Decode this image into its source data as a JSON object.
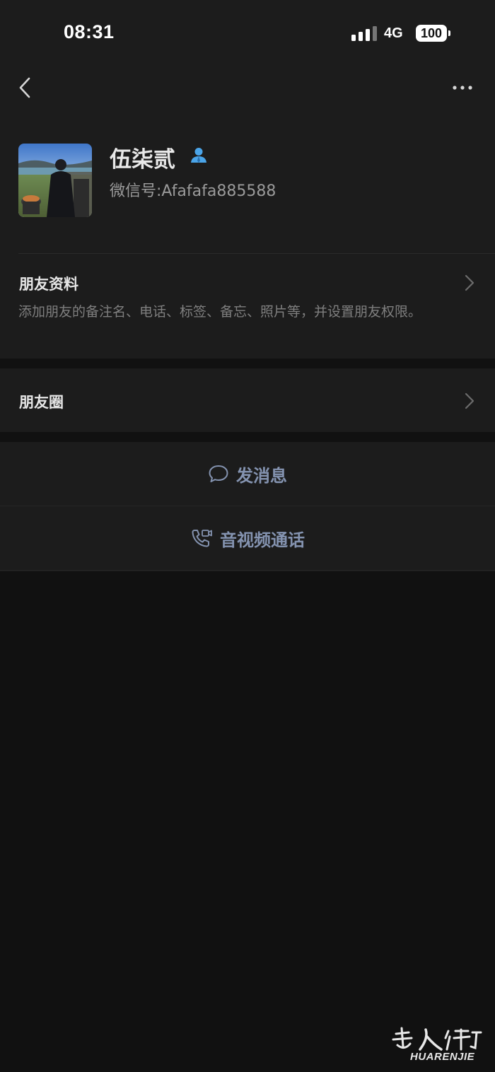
{
  "status_bar": {
    "time": "08:31",
    "network": "4G",
    "battery": "100"
  },
  "nav": {
    "back_icon": "chevron-left-icon",
    "more_icon": "more-dots-icon"
  },
  "profile": {
    "name": "伍柒贰",
    "wechat_id_label": "微信号:",
    "wechat_id": "Afafafa885588",
    "badge_icon": "contact-person-icon",
    "badge_color": "#4aa4e8"
  },
  "friend_info": {
    "title": "朋友资料",
    "description": "添加朋友的备注名、电话、标签、备忘、照片等，并设置朋友权限。"
  },
  "moments": {
    "title": "朋友圈"
  },
  "actions": {
    "send_message": "发消息",
    "av_call": "音视频通话",
    "accent_color": "#8493b0"
  },
  "watermark": {
    "text": "HUARENJIE",
    "logo_text": "華人街"
  }
}
